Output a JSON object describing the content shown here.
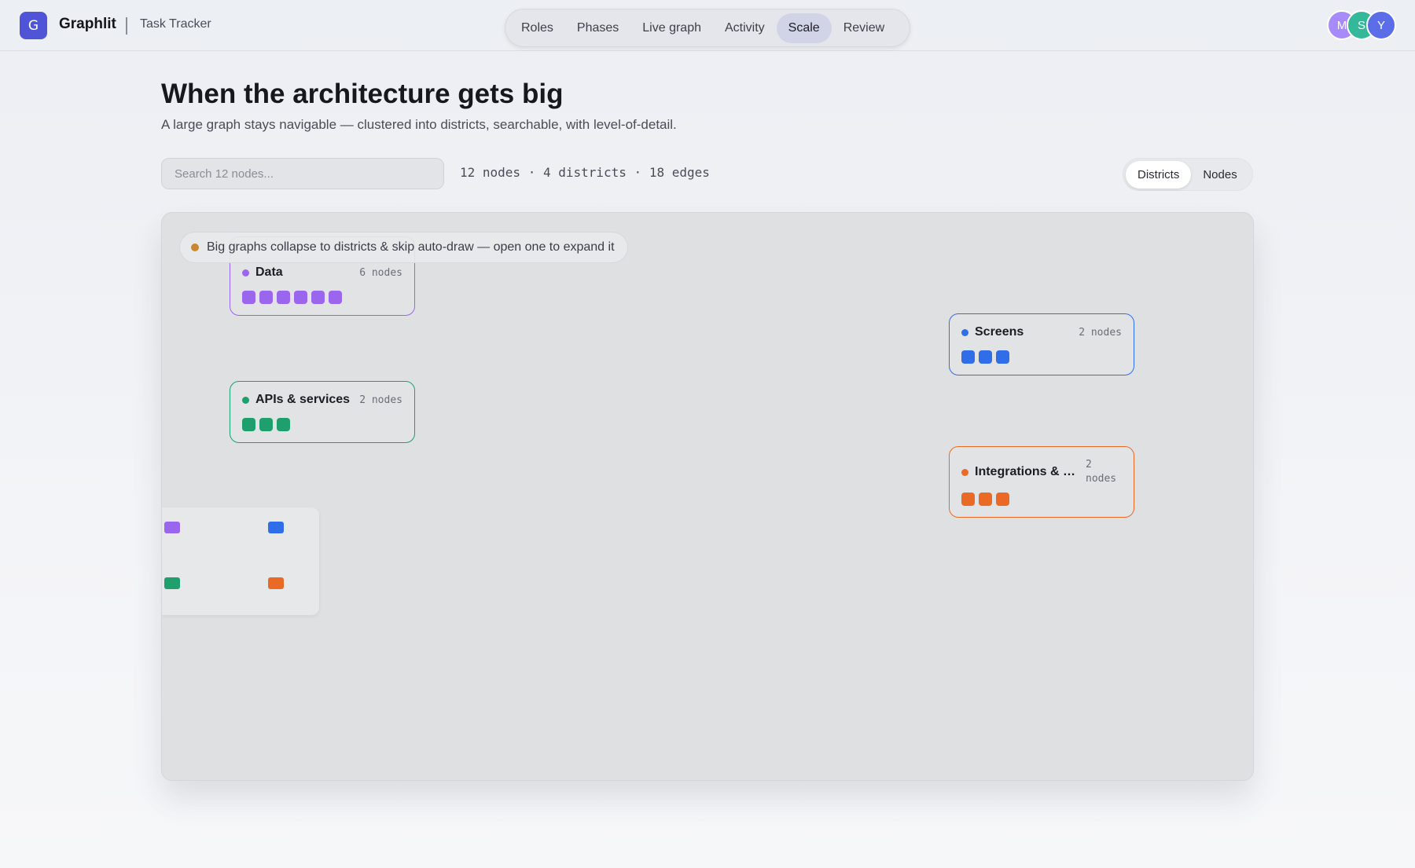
{
  "app": {
    "logo_letter": "G",
    "name": "Graphlit",
    "project": "Task Tracker"
  },
  "nav": {
    "tabs": [
      "Roles",
      "Phases",
      "Live graph",
      "Activity",
      "Scale",
      "Review"
    ],
    "active": "Scale"
  },
  "avatars": [
    {
      "letter": "M",
      "color": "#a78bfa"
    },
    {
      "letter": "S",
      "color": "#34b89a"
    },
    {
      "letter": "Y",
      "color": "#5b6ee8"
    }
  ],
  "page": {
    "title": "When the architecture gets big",
    "subtitle": "A large graph stays navigable — clustered into districts, searchable, with level-of-detail."
  },
  "search": {
    "placeholder": "Search 12 nodes..."
  },
  "stats": "12 nodes · 4 districts · 18 edges",
  "view_toggle": {
    "options": [
      "Districts",
      "Nodes"
    ],
    "active": "Districts"
  },
  "notice": "Big graphs collapse to districts & skip auto-draw — open one to expand it",
  "districts": [
    {
      "id": "data",
      "name": "Data",
      "count": "6 nodes",
      "color": "#9b66ee",
      "squares": 6
    },
    {
      "id": "apis",
      "name": "APIs & services",
      "count": "2 nodes",
      "color": "#1f9e6e",
      "squares": 3
    },
    {
      "id": "screens",
      "name": "Screens",
      "count": "2 nodes",
      "color": "#2f6ee8",
      "squares": 3
    },
    {
      "id": "integrations",
      "name": "Integrations & a...",
      "count": "2 nodes",
      "color": "#ea6a25",
      "squares": 3
    }
  ],
  "minimap": {
    "colors": [
      "#9b66ee",
      "#2f6ee8",
      "#1f9e6e",
      "#ea6a25"
    ]
  }
}
